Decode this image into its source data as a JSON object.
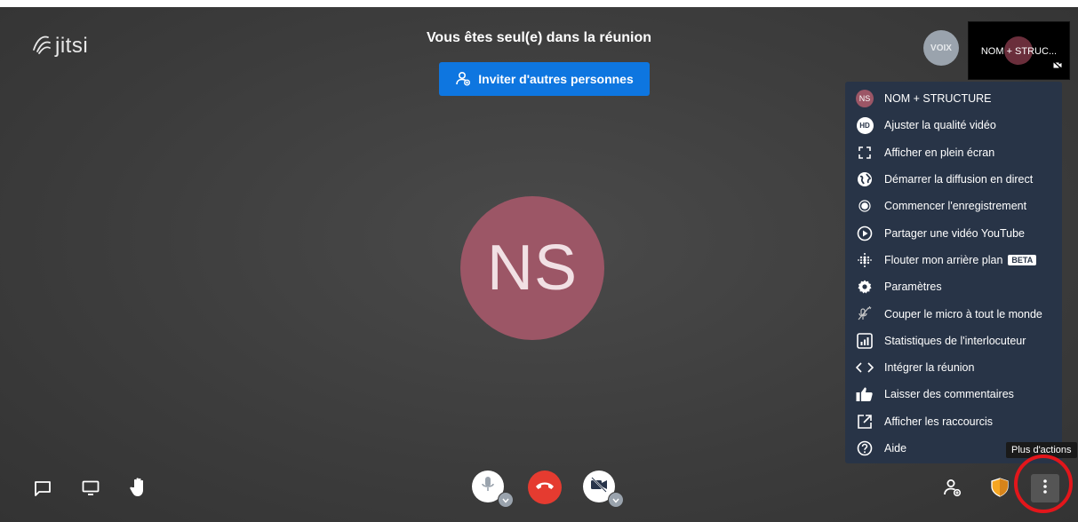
{
  "header": {
    "logo_text": "jitsi",
    "title": "Vous êtes seul(e) dans la réunion",
    "invite_label": "Inviter d'autres personnes"
  },
  "participant": {
    "initials": "NS"
  },
  "thumbnails": {
    "voix_label": "VOIX",
    "self_label": "NOM + STRUC..."
  },
  "menu": {
    "items": [
      {
        "label": "NOM + STRUCTURE",
        "icon": "avatar-icon"
      },
      {
        "label": "Ajuster la qualité vidéo",
        "icon": "hd-icon"
      },
      {
        "label": "Afficher en plein écran",
        "icon": "fullscreen-icon"
      },
      {
        "label": "Démarrer la diffusion en direct",
        "icon": "globe-icon"
      },
      {
        "label": "Commencer l'enregistrement",
        "icon": "record-icon"
      },
      {
        "label": "Partager une vidéo YouTube",
        "icon": "play-icon"
      },
      {
        "label": "Flouter mon arrière plan",
        "icon": "blur-icon",
        "badge": "BETA"
      },
      {
        "label": "Paramètres",
        "icon": "gear-icon"
      },
      {
        "label": "Couper le micro à tout le monde",
        "icon": "mute-all-icon"
      },
      {
        "label": "Statistiques de l'interlocuteur",
        "icon": "stats-icon"
      },
      {
        "label": "Intégrer la réunion",
        "icon": "embed-icon"
      },
      {
        "label": "Laisser des commentaires",
        "icon": "thumbs-up-icon"
      },
      {
        "label": "Afficher les raccourcis",
        "icon": "external-icon"
      },
      {
        "label": "Aide",
        "icon": "help-icon"
      }
    ],
    "avatar_initials": "NS",
    "hd_text": "HD"
  },
  "tooltip": {
    "more_actions": "Plus d'actions"
  },
  "colors": {
    "accent": "#0e76e0",
    "hangup": "#e53b30",
    "avatar": "#9c5666",
    "menu_bg": "#283447",
    "security": "#f5a623",
    "highlight_ring": "#e3161b"
  }
}
